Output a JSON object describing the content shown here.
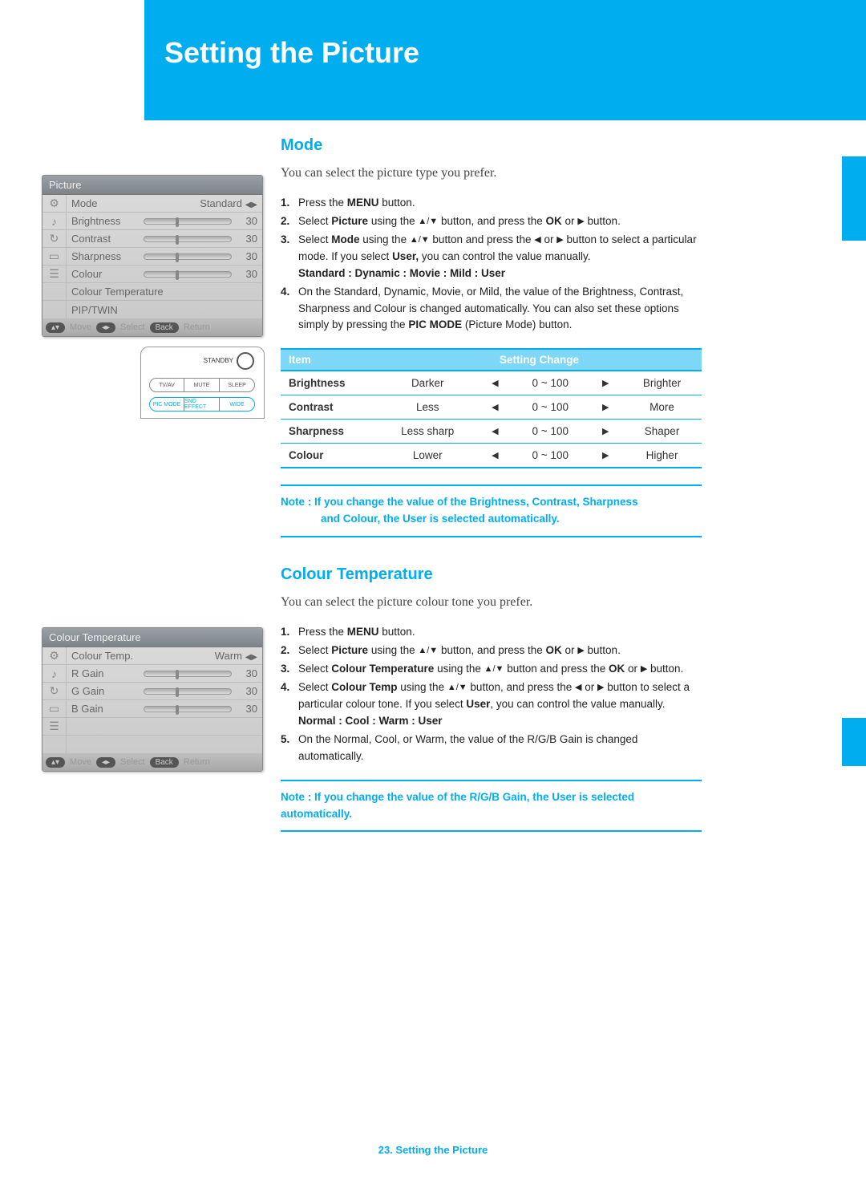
{
  "header": {
    "title": "Setting the Picture"
  },
  "footer": {
    "page_label": "23. Setting the Picture"
  },
  "sections": {
    "mode": {
      "heading": "Mode",
      "intro": "You can select the picture type you prefer.",
      "steps": {
        "s1_pre": "Press the ",
        "s1_b1": "MENU",
        "s1_post": " button.",
        "s2_pre": "Select ",
        "s2_b1": "Picture",
        "s2_mid1": " using the ",
        "s2_mid2": " button, and press the ",
        "s2_b2": "OK",
        "s2_mid3": " or ",
        "s2_post": " button.",
        "s3_pre": "Select ",
        "s3_b1": "Mode",
        "s3_mid1": " using the ",
        "s3_mid2": " button and press the ",
        "s3_mid3": " or ",
        "s3_mid4": " button to select a particular mode. If you select ",
        "s3_b2": "User,",
        "s3_post": " you can control the value manually.",
        "s3_opts": "Standard : Dynamic : Movie : Mild : User",
        "s4_pre": "On the Standard, Dynamic, Movie, or Mild, the value of the Brightness, Contrast, Sharpness and Colour is changed automatically. You can also set these options simply by pressing the ",
        "s4_b1": "PIC MODE",
        "s4_post": " (Picture Mode) button."
      },
      "table": {
        "head_item": "Item",
        "head_change": "Setting Change",
        "rows": [
          {
            "item": "Brightness",
            "low": "Darker",
            "range": "0 ~ 100",
            "high": "Brighter"
          },
          {
            "item": "Contrast",
            "low": "Less",
            "range": "0 ~ 100",
            "high": "More"
          },
          {
            "item": "Sharpness",
            "low": "Less sharp",
            "range": "0 ~ 100",
            "high": "Shaper"
          },
          {
            "item": "Colour",
            "low": "Lower",
            "range": "0 ~ 100",
            "high": "Higher"
          }
        ]
      },
      "note_l1": "Note : If you change the value of the Brightness, Contrast, Sharpness",
      "note_l2": "and Colour, the User is selected automatically."
    },
    "colour_temp": {
      "heading": "Colour Temperature",
      "intro": "You can select the picture colour tone you prefer.",
      "steps": {
        "s1_pre": "Press the ",
        "s1_b1": "MENU",
        "s1_post": " button.",
        "s2_pre": "Select ",
        "s2_b1": "Picture",
        "s2_mid1": " using the ",
        "s2_mid2": " button, and press the ",
        "s2_b2": "OK",
        "s2_mid3": " or ",
        "s2_post": " button.",
        "s3_pre": "Select ",
        "s3_b1": "Colour Temperature",
        "s3_mid1": " using the ",
        "s3_mid2": " button and press the ",
        "s3_b2": "OK",
        "s3_mid3": " or ",
        "s3_post": " button.",
        "s4_pre": "Select ",
        "s4_b1": "Colour Temp",
        "s4_mid1": " using the ",
        "s4_mid2": " button, and press the ",
        "s4_mid3": " or ",
        "s4_mid4": " button to select a particular colour tone. If you select ",
        "s4_b2": "User",
        "s4_post": ", you can control the value manually.",
        "s4_opts": "Normal : Cool : Warm : User",
        "s5": "On the Normal, Cool, or Warm, the value of the R/G/B Gain is changed automatically."
      },
      "note_l1": "Note : If you change the value of the R/G/B Gain, the User is selected",
      "note_l2": "automatically."
    }
  },
  "osd1": {
    "title": "Picture",
    "rows": [
      {
        "icon": "⚙",
        "label": "Mode",
        "value_text": "Standard",
        "has_slider": false
      },
      {
        "icon": "♪",
        "label": "Brightness",
        "value": "30",
        "has_slider": true
      },
      {
        "icon": "↻",
        "label": "Contrast",
        "value": "30",
        "has_slider": true
      },
      {
        "icon": "▭",
        "label": "Sharpness",
        "value": "30",
        "has_slider": true
      },
      {
        "icon": "☰",
        "label": "Colour",
        "value": "30",
        "has_slider": true
      },
      {
        "icon": "",
        "label": "Colour Temperature",
        "value_text": "",
        "has_slider": false
      },
      {
        "icon": "",
        "label": "PIP/TWIN",
        "value_text": "",
        "has_slider": false
      }
    ],
    "footer": {
      "move": "Move",
      "select": "Select",
      "back": "Back",
      "ret": "Return"
    }
  },
  "osd2": {
    "title": "Colour Temperature",
    "rows": [
      {
        "icon": "⚙",
        "label": "Colour Temp.",
        "value_text": "Warm",
        "has_slider": false
      },
      {
        "icon": "♪",
        "label": "R Gain",
        "value": "30",
        "has_slider": true
      },
      {
        "icon": "↻",
        "label": "G Gain",
        "value": "30",
        "has_slider": true
      },
      {
        "icon": "▭",
        "label": "B Gain",
        "value": "30",
        "has_slider": true
      },
      {
        "icon": "☰",
        "label": "",
        "value_text": "",
        "has_slider": false
      },
      {
        "icon": "",
        "label": "",
        "value_text": "",
        "has_slider": false
      }
    ],
    "footer": {
      "move": "Move",
      "select": "Select",
      "back": "Back",
      "ret": "Return"
    }
  },
  "remote": {
    "standby": "STANDBY",
    "row1": [
      "TV/AV",
      "MUTE",
      "SLEEP"
    ],
    "row2": [
      "PIC MODE",
      "SND EFFECT",
      "WIDE"
    ]
  },
  "glyphs": {
    "up": "▲",
    "down": "▼",
    "left": "◀",
    "right": "▶",
    "updown": "▲/▼",
    "lr": "◀▶"
  }
}
